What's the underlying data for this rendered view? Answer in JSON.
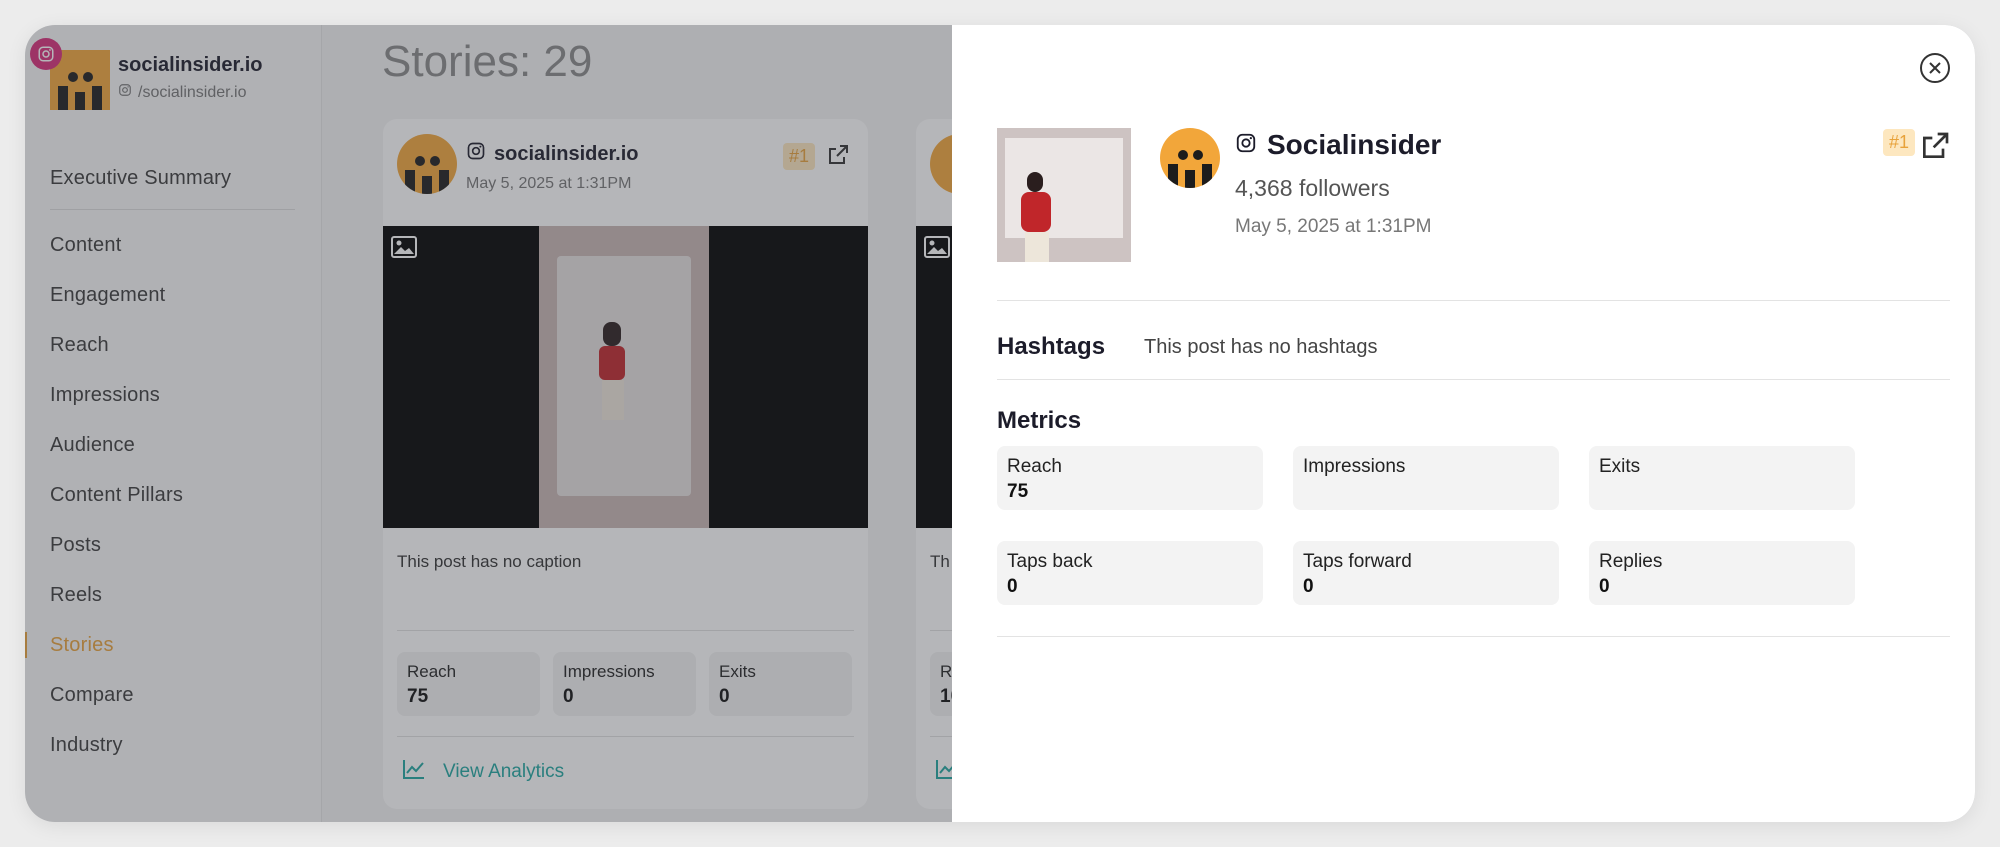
{
  "brand": {
    "name": "socialinsider.io",
    "handle": "/socialinsider.io"
  },
  "sidebar": {
    "items": [
      {
        "label": "Executive Summary"
      },
      {
        "label": "Content"
      },
      {
        "label": "Engagement"
      },
      {
        "label": "Reach"
      },
      {
        "label": "Impressions"
      },
      {
        "label": "Audience"
      },
      {
        "label": "Content Pillars"
      },
      {
        "label": "Posts"
      },
      {
        "label": "Reels"
      },
      {
        "label": "Stories"
      },
      {
        "label": "Compare"
      },
      {
        "label": "Industry"
      }
    ],
    "active": "Stories"
  },
  "main": {
    "title": "Stories: 29"
  },
  "card": {
    "account": "socialinsider.io",
    "date": "May 5, 2025 at 1:31PM",
    "rank": "#1",
    "caption": "This post has no caption",
    "metrics": [
      {
        "label": "Reach",
        "value": "75"
      },
      {
        "label": "Impressions",
        "value": "0"
      },
      {
        "label": "Exits",
        "value": "0"
      }
    ],
    "view_analytics": "View Analytics"
  },
  "card2": {
    "caption_partial": "Th",
    "metric_label_partial": "R",
    "metric_value_partial": "10"
  },
  "panel": {
    "name": "Socialinsider",
    "followers": "4,368 followers",
    "date": "May 5, 2025 at 1:31PM",
    "rank": "#1",
    "hashtags_heading": "Hashtags",
    "hashtags_text": "This post has no hashtags",
    "metrics_heading": "Metrics",
    "metrics": [
      {
        "label": "Reach",
        "value": "75"
      },
      {
        "label": "Impressions",
        "value": ""
      },
      {
        "label": "Exits",
        "value": ""
      },
      {
        "label": "Taps back",
        "value": "0"
      },
      {
        "label": "Taps forward",
        "value": "0"
      },
      {
        "label": "Replies",
        "value": "0"
      }
    ]
  },
  "colors": {
    "accent": "#e8a23a",
    "brand_orange": "#f2a63a",
    "instagram": "#d82e7a",
    "link_teal": "#1fa6a0"
  },
  "icons": {
    "instagram": "instagram-icon",
    "external": "external-link-icon",
    "close": "close-icon",
    "image": "image-icon",
    "chart": "line-chart-icon"
  }
}
